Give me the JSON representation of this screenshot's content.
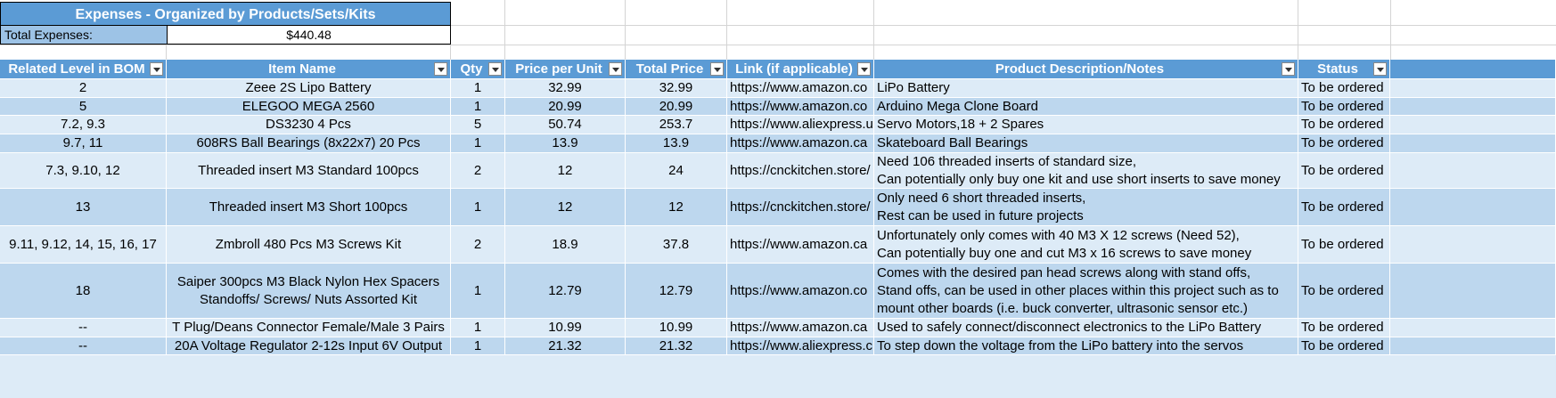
{
  "sheet": {
    "title": "Expenses - Organized by Products/Sets/Kits",
    "total_label": "Total Expenses:",
    "total_value": "$440.48"
  },
  "table": {
    "headers": [
      "Related Level in BOM",
      "Item Name",
      "Qty",
      "Price per Unit",
      "Total Price",
      "Link (if applicable)",
      "Product Description/Notes",
      "Status"
    ],
    "rows": [
      {
        "bom": "2",
        "item": [
          "Zeee 2S Lipo Battery"
        ],
        "qty": "1",
        "price": "32.99",
        "total": "32.99",
        "link": "https://www.amazon.co",
        "notes": [
          "LiPo Battery"
        ],
        "status": "To be ordered"
      },
      {
        "bom": "5",
        "item": [
          "ELEGOO MEGA 2560"
        ],
        "qty": "1",
        "price": "20.99",
        "total": "20.99",
        "link": "https://www.amazon.co",
        "notes": [
          "Arduino Mega Clone Board"
        ],
        "status": "To be ordered"
      },
      {
        "bom": "7.2, 9.3",
        "item": [
          "DS3230 4 Pcs"
        ],
        "qty": "5",
        "price": "50.74",
        "total": "253.7",
        "link": "https://www.aliexpress.u",
        "notes": [
          "Servo Motors,18 + 2 Spares"
        ],
        "status": "To be ordered"
      },
      {
        "bom": "9.7, 11",
        "item": [
          "608RS Ball Bearings (8x22x7) 20 Pcs"
        ],
        "qty": "1",
        "price": "13.9",
        "total": "13.9",
        "link": "https://www.amazon.ca",
        "notes": [
          "Skateboard Ball Bearings"
        ],
        "status": "To be ordered"
      },
      {
        "bom": "7.3, 9.10, 12",
        "item": [
          "Threaded insert M3 Standard 100pcs"
        ],
        "qty": "2",
        "price": "12",
        "total": "24",
        "link": "https://cnckitchen.store/",
        "notes": [
          "Need 106 threaded inserts of standard size,",
          "Can potentially only buy one kit and use short inserts to save money"
        ],
        "status": "To be ordered"
      },
      {
        "bom": "13",
        "item": [
          "Threaded insert M3 Short 100pcs"
        ],
        "qty": "1",
        "price": "12",
        "total": "12",
        "link": "https://cnckitchen.store/",
        "notes": [
          "Only need 6 short threaded inserts,",
          "Rest can be used in future projects"
        ],
        "status": "To be ordered"
      },
      {
        "bom": "9.11, 9.12, 14, 15, 16, 17",
        "item": [
          "Zmbroll 480 Pcs M3 Screws Kit"
        ],
        "qty": "2",
        "price": "18.9",
        "total": "37.8",
        "link": "https://www.amazon.ca",
        "notes": [
          "Unfortunately only comes with 40 M3 X 12 screws (Need 52),",
          "Can potentially buy one and cut M3 x 16 screws to save money"
        ],
        "status": "To be ordered"
      },
      {
        "bom": "18",
        "item": [
          "Saiper 300pcs M3 Black Nylon Hex Spacers",
          "Standoffs/ Screws/ Nuts Assorted Kit"
        ],
        "qty": "1",
        "price": "12.79",
        "total": "12.79",
        "link": "https://www.amazon.co",
        "notes": [
          "Comes with the desired pan head screws along with stand offs,",
          "Stand offs, can be used in other places within this project such as to",
          "mount other boards (i.e. buck converter, ultrasonic sensor etc.)"
        ],
        "status": "To be ordered"
      },
      {
        "bom": "--",
        "item": [
          "T Plug/Deans Connector Female/Male 3 Pairs"
        ],
        "qty": "1",
        "price": "10.99",
        "total": "10.99",
        "link": "https://www.amazon.ca",
        "notes": [
          "Used to safely connect/disconnect electronics to the LiPo Battery"
        ],
        "status": "To be ordered"
      },
      {
        "bom": "--",
        "item": [
          "20A Voltage Regulator 2-12s Input 6V Output"
        ],
        "qty": "1",
        "price": "21.32",
        "total": "21.32",
        "link": "https://www.aliexpress.c",
        "notes": [
          "To step down the voltage from the LiPo battery into the servos"
        ],
        "status": "To be ordered"
      }
    ]
  },
  "colors": {
    "header_blue": "#5b9bd5",
    "band_light": "#ddebf7",
    "band_dark": "#bdd7ee"
  }
}
